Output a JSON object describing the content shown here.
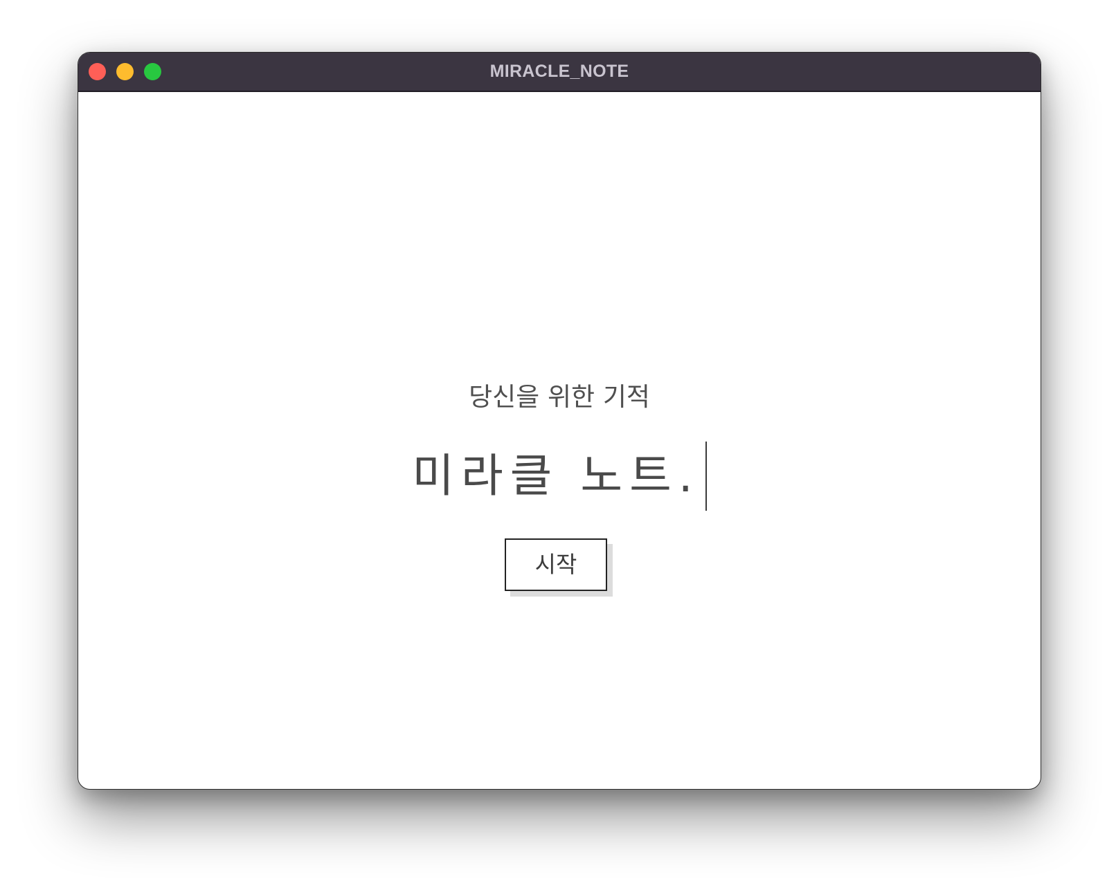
{
  "window": {
    "title": "MIRACLE_NOTE",
    "traffic_lights": {
      "close_color": "#ff5f57",
      "minimize_color": "#febc2e",
      "zoom_color": "#28c840"
    },
    "titlebar_color": "#3b3541"
  },
  "main": {
    "subtitle": "당신을 위한 기적",
    "headline": "미라클 노트.",
    "start_button_label": "시작"
  }
}
